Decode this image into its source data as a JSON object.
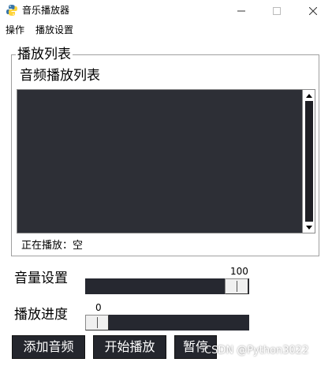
{
  "window": {
    "title": "音乐播放器",
    "icon": "python-icon",
    "controls": [
      "minimize",
      "maximize",
      "close"
    ]
  },
  "menu": {
    "items": [
      {
        "label": "操作"
      },
      {
        "label": "播放设置"
      }
    ]
  },
  "playlist": {
    "group_label": "播放列表",
    "title": "音频播放列表",
    "items": [],
    "now_playing": "正在播放：空"
  },
  "volume": {
    "label": "音量设置",
    "value": "100",
    "level": 1.0
  },
  "progress": {
    "label": "播放进度",
    "value": "0",
    "level": 0.0
  },
  "buttons": {
    "add_audio": "添加音频",
    "start_play": "开始播放",
    "pause": "暂停"
  },
  "watermark": "CSDN @Python3022",
  "colors": {
    "dark_panel": "#2d2f36",
    "button_bg": "#24262d",
    "trough": "#262830"
  }
}
